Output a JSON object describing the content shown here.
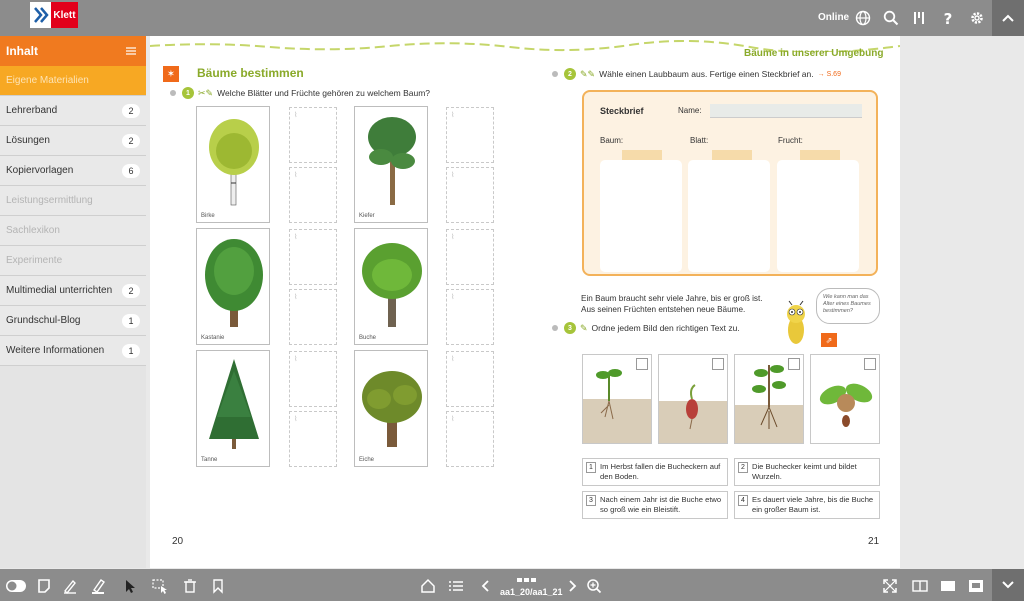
{
  "brand": {
    "name": "Klett"
  },
  "topbar": {
    "online_label": "Online"
  },
  "sidebar": {
    "title": "Inhalt",
    "items": [
      {
        "label": "Eigene Materialien",
        "state": "active"
      },
      {
        "label": "Lehrerband",
        "count": "2"
      },
      {
        "label": "Lösungen",
        "count": "2"
      },
      {
        "label": "Kopiervorlagen",
        "count": "6"
      },
      {
        "label": "Leistungsermittlung",
        "state": "disabled"
      },
      {
        "label": "Sachlexikon",
        "state": "disabled"
      },
      {
        "label": "Experimente",
        "state": "disabled"
      },
      {
        "label": "Multimedial unterrichten",
        "count": "2"
      },
      {
        "label": "Grundschul-Blog",
        "count": "1"
      },
      {
        "label": "Weitere Informationen",
        "count": "1"
      }
    ]
  },
  "page": {
    "right_header": "Bäume in unserer Umgebung",
    "title": "Bäume bestimmen",
    "task1": {
      "num": "1",
      "text": "Welche Blätter und Früchte gehören zu welchem Baum?"
    },
    "trees": [
      "Birke",
      "Kiefer",
      "Kastanie",
      "Buche",
      "Tanne",
      "Eiche"
    ],
    "task2": {
      "num": "2",
      "text": "Wähle einen Laubbaum aus. Fertige einen Steckbrief an.",
      "ref": "→ S.69"
    },
    "steckbrief": {
      "title": "Steckbrief",
      "name_label": "Name:",
      "columns": [
        "Baum:",
        "Blatt:",
        "Frucht:"
      ]
    },
    "intro": [
      "Ein Baum braucht sehr viele Jahre, bis er groß ist.",
      "Aus seinen Früchten entstehen neue Bäume."
    ],
    "bubble": "Wie kann man das Alter eines Baumes bestimmen?",
    "task3": {
      "num": "3",
      "text": "Ordne jedem Bild den richtigen Text zu."
    },
    "texts": [
      {
        "n": "1",
        "text": "Im Herbst fallen die Bucheckern auf den Boden."
      },
      {
        "n": "2",
        "text": "Die Buchecker keimt und bildet Wurzeln."
      },
      {
        "n": "3",
        "text": "Nach einem Jahr ist die Buche etwo so groß wie ein Bleistift."
      },
      {
        "n": "4",
        "text": "Es dauert viele Jahre, bis die Buche ein großer Baum ist."
      }
    ],
    "page_left": "20",
    "page_right": "21"
  },
  "bottombar": {
    "page_label": "aa1_20/aa1_21"
  },
  "colors": {
    "accent_orange": "#f07a1f",
    "active_item": "#f7a823",
    "green": "#8aaa2a",
    "bar_gray": "#8c8c8c"
  }
}
